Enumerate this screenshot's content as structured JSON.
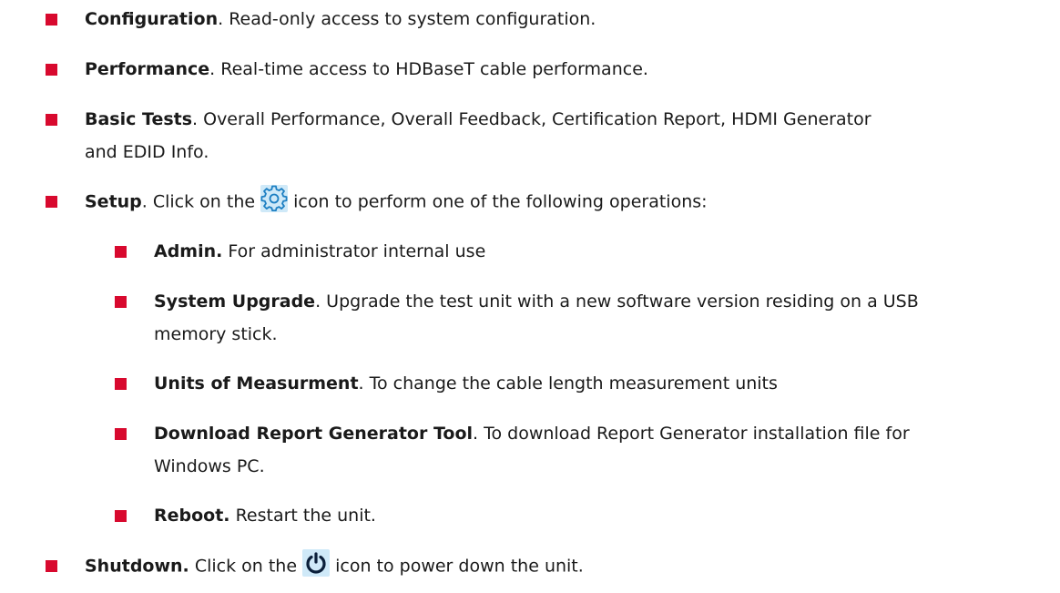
{
  "items": [
    {
      "title": "Configuration",
      "rest": ".  Read-only access to system configuration."
    },
    {
      "title": "Performance",
      "rest": ".  Real-time access to HDBaseT cable performance."
    },
    {
      "title": "Basic Tests",
      "rest": ".  Overall Performance, Overall Feedback, Certification Report, HDMI Generator",
      "rest2": "and EDID Info."
    },
    {
      "title": "Setup",
      "pre": ".  Click on the ",
      "post": " icon to perform one of the following operations:",
      "icon": "gear-icon"
    },
    {
      "title": "Shutdown.",
      "pre": "  Click on the ",
      "post": " icon to power down the unit.",
      "icon": "power-icon"
    }
  ],
  "sub_items": [
    {
      "title": "Admin.",
      "rest": " For administrator internal use"
    },
    {
      "title": "System Upgrade",
      "rest": ".  Upgrade the test unit with a new software version residing on a USB",
      "rest2": "memory stick."
    },
    {
      "title": "Units of Measurment",
      "rest": ".  To change the cable length measurement units"
    },
    {
      "title": "Download Report Generator Tool",
      "rest": ". To download Report Generator installation file for",
      "rest2": "Windows PC."
    },
    {
      "title": "Reboot.",
      "rest": "  Restart the unit."
    }
  ],
  "colors": {
    "bullet": "#d8092e",
    "icon_bg": "#cfe9f8",
    "icon_fg": "#1d7fc2"
  }
}
